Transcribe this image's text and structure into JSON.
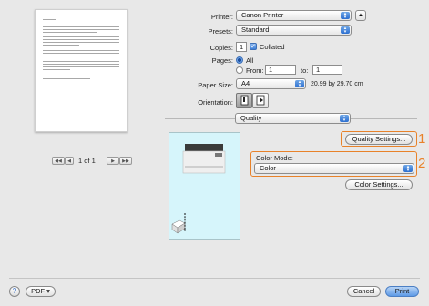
{
  "preview": {
    "page_indicator": "1 of 1",
    "first_btn": "◀◀",
    "prev_btn": "◀",
    "next_btn": "▶",
    "last_btn": "▶▶"
  },
  "printer": {
    "label": "Printer:",
    "value": "Canon Printer"
  },
  "presets": {
    "label": "Presets:",
    "value": "Standard"
  },
  "copies": {
    "label": "Copies:",
    "value": "1",
    "collated_label": "Collated",
    "collated": true
  },
  "pages": {
    "label": "Pages:",
    "all_label": "All",
    "from_label": "From:",
    "from_value": "1",
    "to_label": "to:",
    "to_value": "1"
  },
  "paper_size": {
    "label": "Paper Size:",
    "value": "A4",
    "dimensions": "20.99 by 29.70 cm"
  },
  "orientation": {
    "label": "Orientation:"
  },
  "section_popup": {
    "value": "Quality"
  },
  "quality_settings_button": "Quality Settings...",
  "color_mode": {
    "label": "Color Mode:",
    "value": "Color"
  },
  "color_settings_button": "Color Settings...",
  "callouts": {
    "one": "1",
    "two": "2"
  },
  "footer": {
    "help": "?",
    "pdf": "PDF ▾",
    "cancel": "Cancel",
    "print": "Print"
  },
  "colors": {
    "accent": "#e8822a",
    "preview_bg": "#d6f5fb",
    "primary_button": "#5e9ae6"
  }
}
